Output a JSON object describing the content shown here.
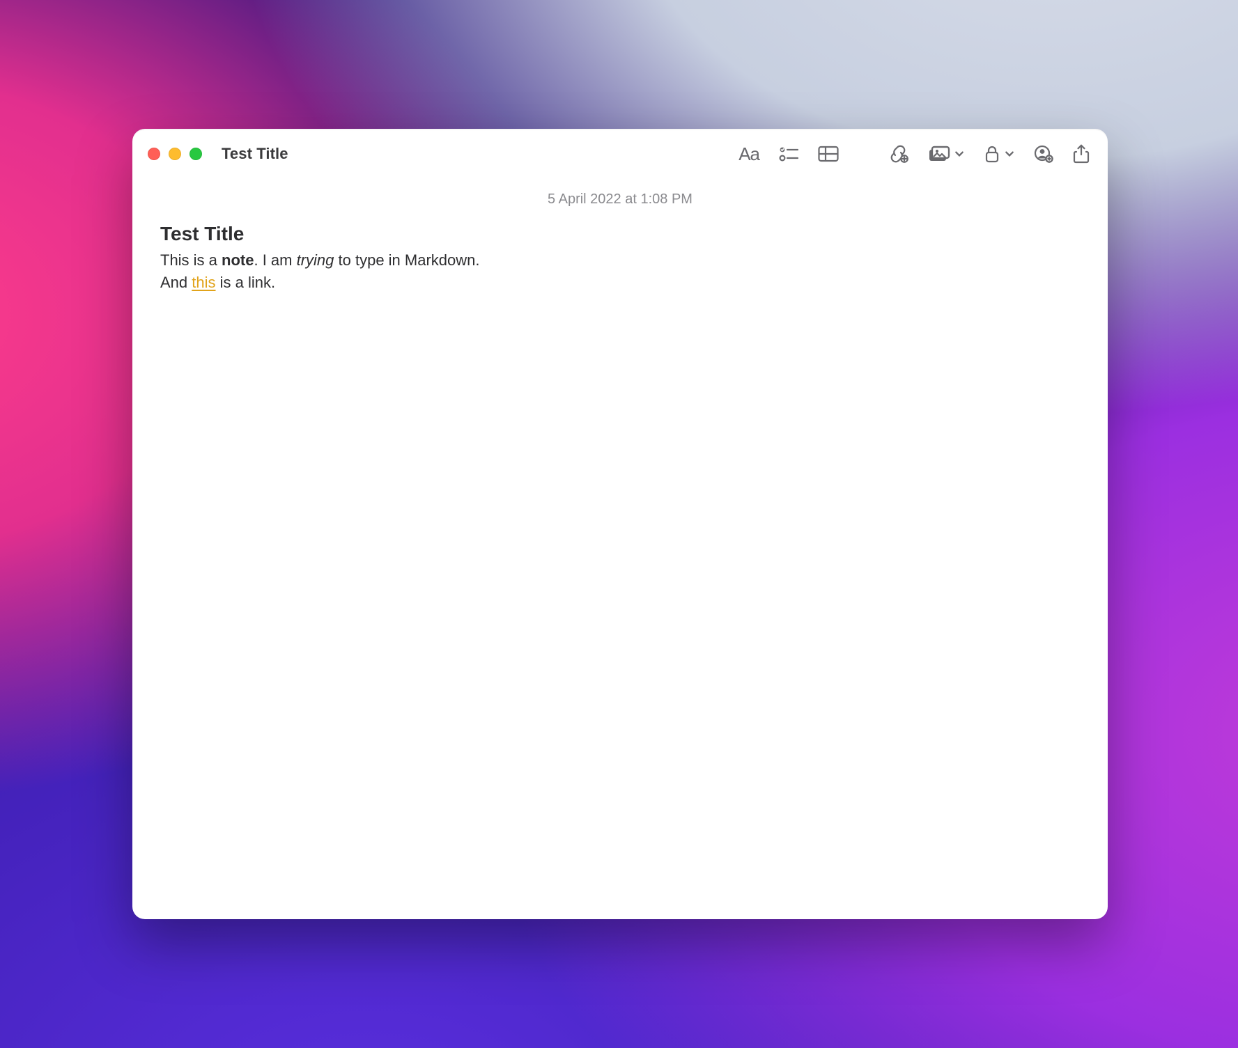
{
  "window": {
    "title": "Test Title"
  },
  "toolbar": {
    "format_label": "Aa",
    "icons": {
      "format": "format-text-icon",
      "checklist": "checklist-icon",
      "table": "table-icon",
      "link": "link-attachment-icon",
      "media": "photos-icon",
      "lock": "lock-icon",
      "collaborate": "collaborate-icon",
      "share": "share-icon"
    }
  },
  "note": {
    "timestamp": "5 April 2022 at 1:08 PM",
    "title": "Test Title",
    "body": {
      "line1": {
        "seg1": "This is a ",
        "bold": "note",
        "seg2": ". I am ",
        "italic": "trying",
        "seg3": " to type in Markdown."
      },
      "line2": {
        "seg1": "And ",
        "link_text": "this",
        "seg2": " is a link."
      }
    }
  },
  "colors": {
    "link": "#E1A31A",
    "toolbar_icon": "#6a6a6e",
    "timestamp": "#8a8a8e"
  }
}
